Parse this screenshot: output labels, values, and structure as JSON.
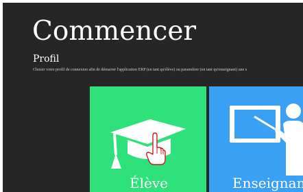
{
  "page": {
    "title": "Commencer",
    "section_title": "Profil",
    "description": "Choisir votre profil de connexion afin de démarrer l'application ERP (en tant qu'élève) ou paramétrer (en tant qu'enseignant) une s"
  },
  "profiles": [
    {
      "label": "Élève",
      "icon": "graduation-cap-icon",
      "color": "#2ee17a"
    },
    {
      "label": "Enseignant",
      "icon": "teacher-board-icon",
      "color": "#3aa0f3"
    }
  ],
  "cursor": {
    "icon": "hand-pointer-icon"
  }
}
